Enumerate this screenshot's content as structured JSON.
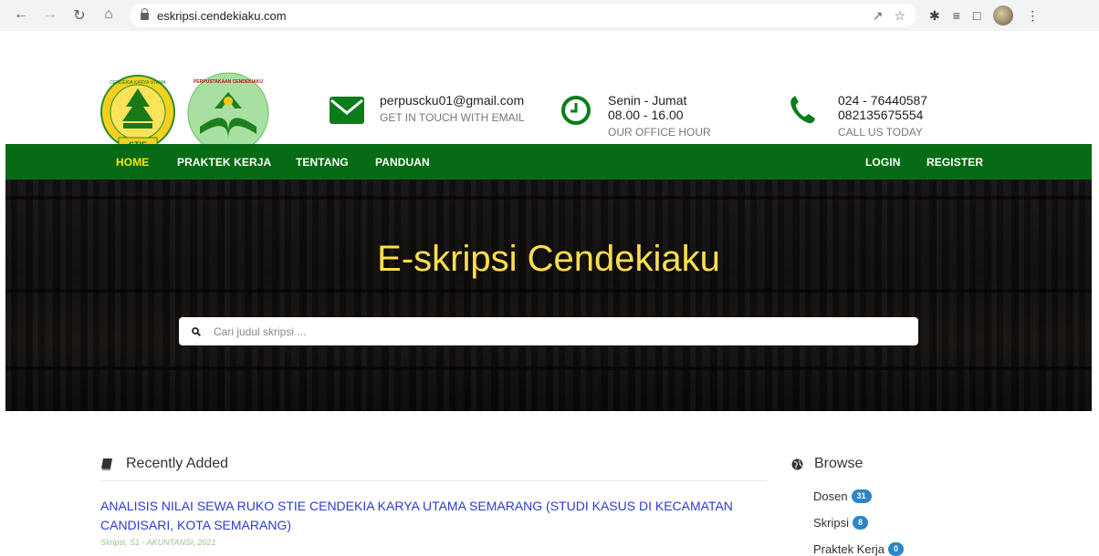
{
  "browser": {
    "url": "eskripsi.cendekiaku.com"
  },
  "logos": {
    "stie_text": "STIE",
    "stie_ring_text": "CENDEKIA KARYA UTAMA",
    "perpus_ring_text": "PERPUSTAKAAN CENDEKIAKU"
  },
  "contacts": [
    {
      "icon": "envelope-icon",
      "line1": "perpuscku01@gmail.com",
      "line2": "",
      "caption": "GET IN TOUCH WITH EMAIL"
    },
    {
      "icon": "clock-icon",
      "line1": "Senin - Jumat",
      "line2": "08.00 - 16.00",
      "caption": "OUR OFFICE HOUR"
    },
    {
      "icon": "phone-icon",
      "line1": "024 - 76440587",
      "line2": "082135675554",
      "caption": "CALL US TODAY"
    }
  ],
  "nav": {
    "left": [
      {
        "label": "HOME",
        "active": true
      },
      {
        "label": "PRAKTEK KERJA",
        "active": false
      },
      {
        "label": "TENTANG",
        "active": false
      },
      {
        "label": "PANDUAN",
        "active": false
      }
    ],
    "right": [
      {
        "label": "LOGIN"
      },
      {
        "label": "REGISTER"
      }
    ]
  },
  "hero": {
    "title": "E-skripsi Cendekiaku",
    "search_placeholder": "Cari judul skripsi ..."
  },
  "recent": {
    "heading": "Recently Added",
    "items": [
      {
        "title": "ANALISIS NILAI SEWA RUKO STIE CENDEKIA KARYA UTAMA SEMARANG (STUDI KASUS DI KECAMATAN CANDISARI, KOTA SEMARANG)",
        "meta": "Skripsi, S1 - AKUNTANSI, 2021"
      }
    ]
  },
  "browse": {
    "heading": "Browse",
    "items": [
      {
        "label": "Dosen",
        "count": "31"
      },
      {
        "label": "Skripsi",
        "count": "8"
      },
      {
        "label": "Praktek Kerja",
        "count": "0"
      }
    ]
  },
  "colors": {
    "nav_bg": "#066b14",
    "nav_active": "#ffe400",
    "hero_title": "#ffe04a",
    "link": "#2b3bd1",
    "badge": "#2a86c6",
    "icon_green": "#0a7d1a"
  }
}
